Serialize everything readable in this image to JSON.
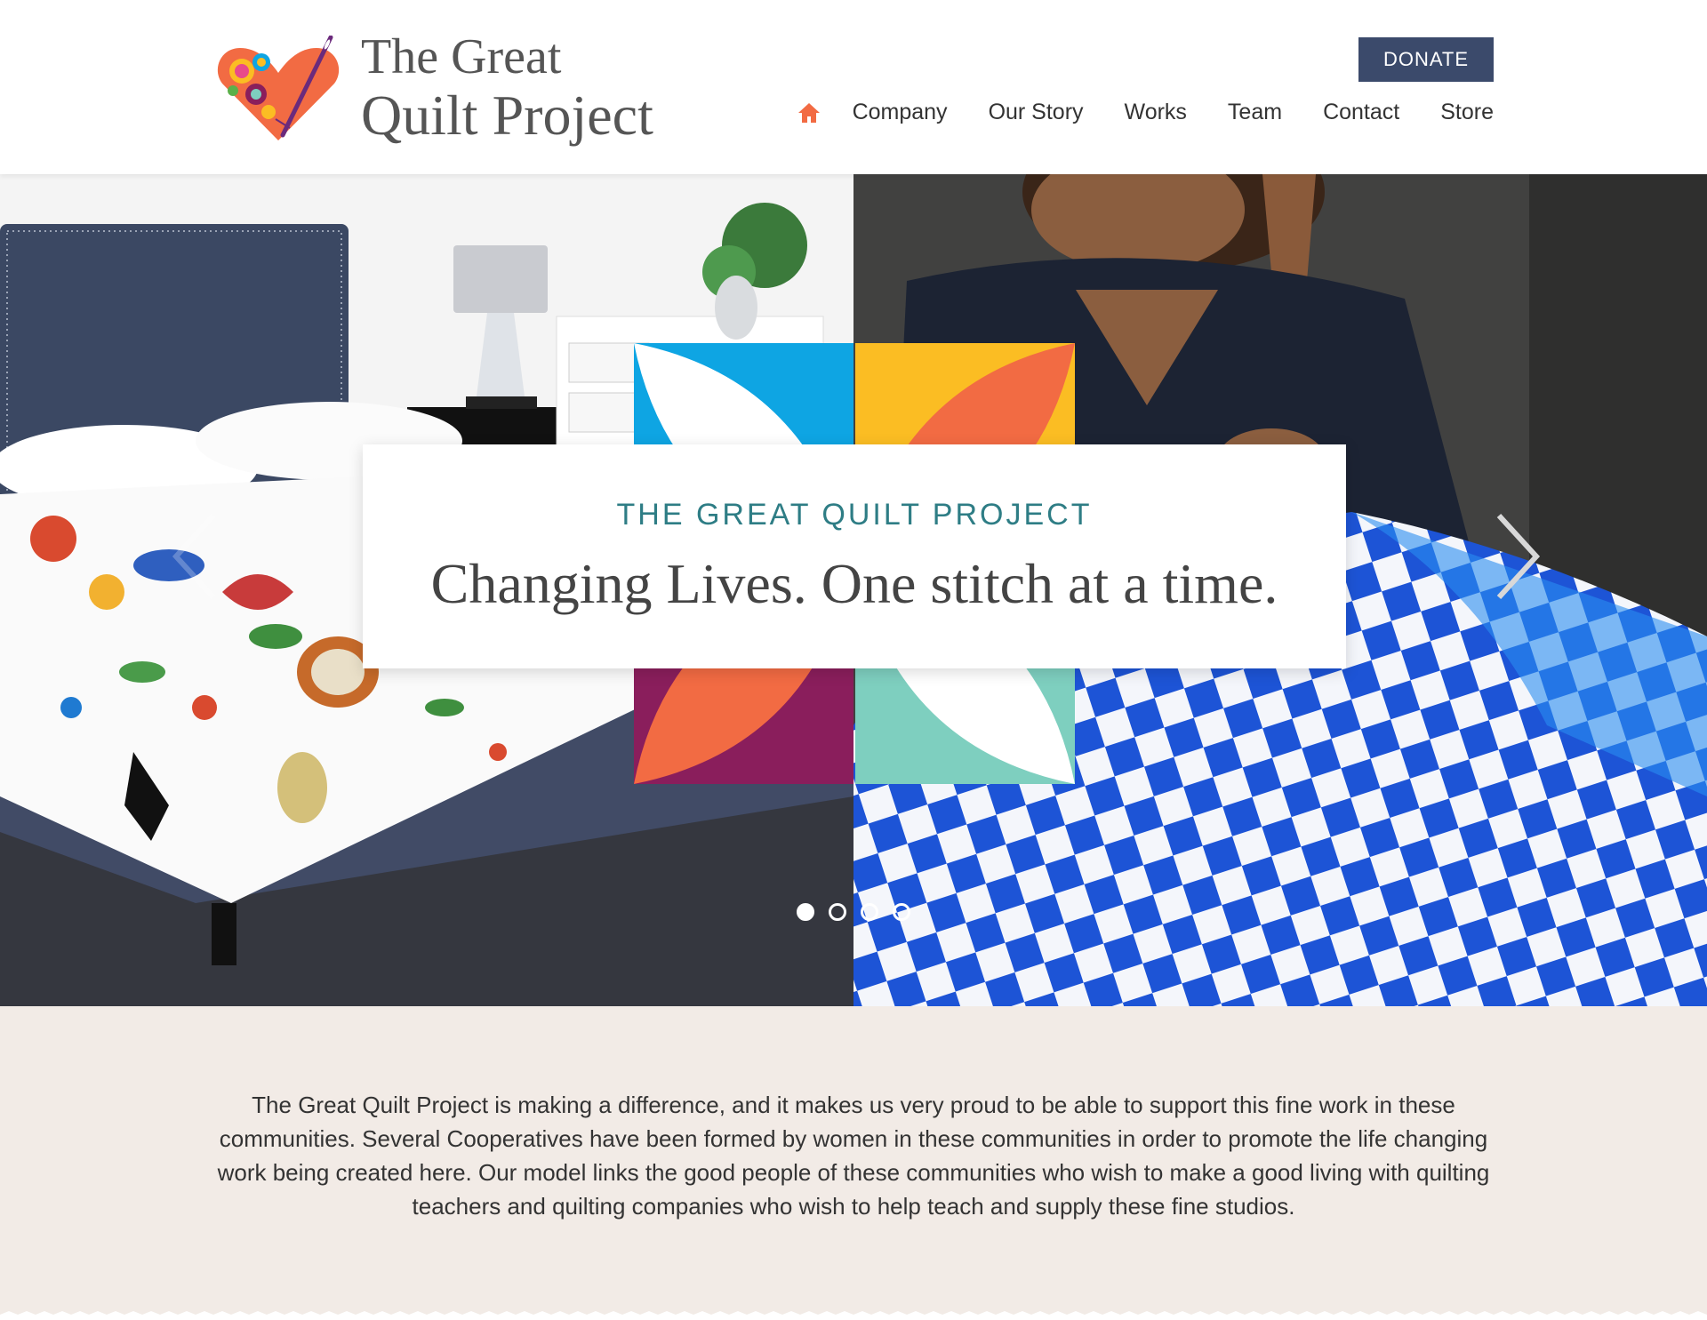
{
  "header": {
    "logo_line1": "The Great",
    "logo_line2": "Quilt Project",
    "logo_icon": "heart-quilt-needle-logo",
    "donate_label": "DONATE",
    "nav": {
      "home_icon": "home-icon",
      "items": [
        "Company",
        "Our Story",
        "Works",
        "Team",
        "Contact",
        "Store"
      ]
    }
  },
  "hero": {
    "kicker": "THE GREAT QUILT PROJECT",
    "headline": "Changing Lives. One stitch at a time.",
    "slide_count": 4,
    "active_slide": 1,
    "prev_icon": "chevron-left-icon",
    "next_icon": "chevron-right-icon"
  },
  "about": {
    "text": "The Great Quilt Project is making a difference, and it makes us very proud to be able to support this fine work in these communities. Several Cooperatives have been formed by women in these communities in order to promote the life changing work being created here. Our model links the good people of these communities who wish to make a good living with quilting teachers and quilting companies who wish to help teach and supply these fine studios."
  },
  "colors": {
    "accent_orange": "#f26b43",
    "navy_button": "#3b4a6b",
    "teal_text": "#2e7d85",
    "tile_blue": "#0ea5e3",
    "tile_yellow": "#fbbd23",
    "tile_purple": "#8a1e5c",
    "tile_mint": "#7ecfbf",
    "about_bg": "#f2ebe6"
  }
}
